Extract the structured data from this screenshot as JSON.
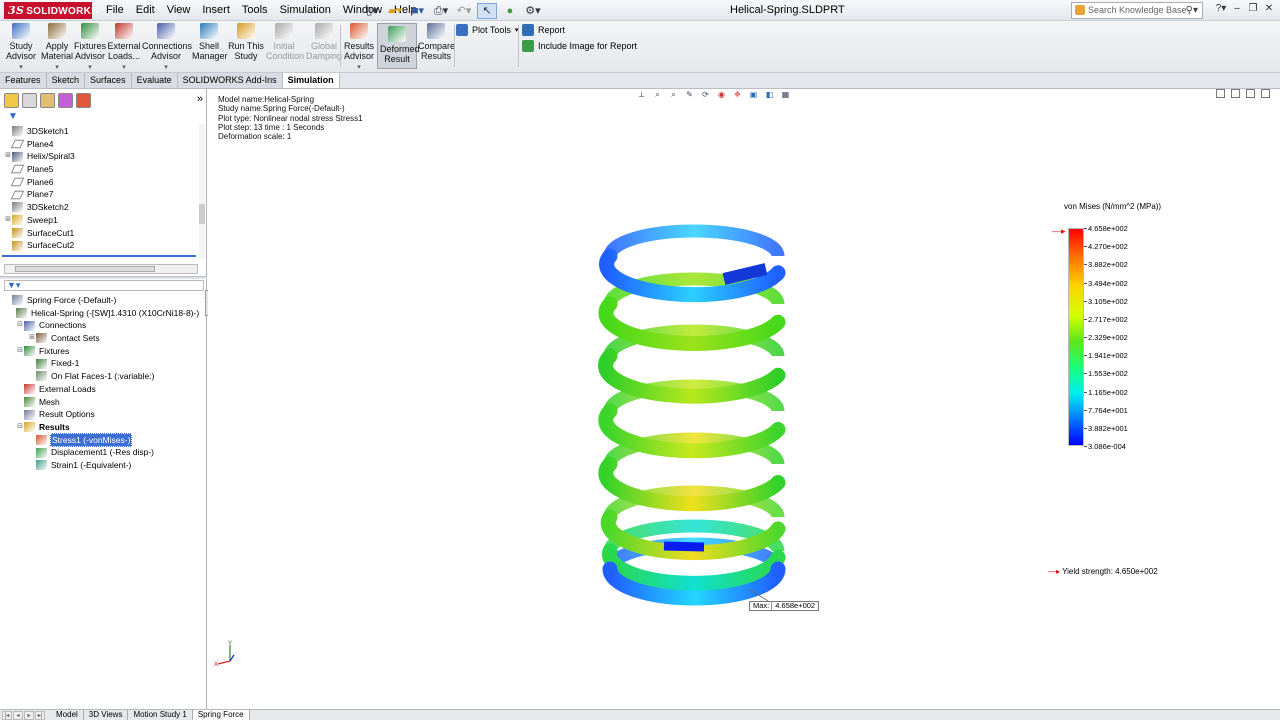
{
  "app": {
    "logo": "SOLIDWORKS",
    "logo_mark": "3S",
    "title": "Helical-Spring.SLDPRT",
    "menu": [
      "File",
      "Edit",
      "View",
      "Insert",
      "Tools",
      "Simulation",
      "Window",
      "Help"
    ],
    "search_placeholder": "Search Knowledge Base"
  },
  "ribbon": {
    "buttons": [
      {
        "label": "Study\nAdvisor",
        "icon": "study-advisor-icon",
        "color": "#3a6fc4"
      },
      {
        "label": "Apply\nMaterial",
        "icon": "material-icon",
        "color": "#8a6a3a"
      },
      {
        "label": "Fixtures\nAdvisor",
        "icon": "fixtures-icon",
        "color": "#2f8b3f"
      },
      {
        "label": "External\nLoads...",
        "icon": "loads-icon",
        "color": "#c4362f"
      },
      {
        "label": "Connections\nAdvisor",
        "icon": "connections-icon",
        "color": "#4a5fa8"
      },
      {
        "label": "Shell\nManager",
        "icon": "shell-icon",
        "color": "#2a7ab8"
      },
      {
        "label": "Run This\nStudy",
        "icon": "run-icon",
        "color": "#d69a1e"
      },
      {
        "label": "Initial\nCondition",
        "icon": "initial-condition-icon",
        "color": "#aaaaaa"
      },
      {
        "label": "Global\nDamping",
        "icon": "damping-icon",
        "color": "#aaaaaa"
      },
      {
        "label": "Results\nAdvisor",
        "icon": "results-icon",
        "color": "#d8562a"
      },
      {
        "label": "Deformed\nResult",
        "icon": "deformed-icon",
        "color": "#3f9c5a"
      },
      {
        "label": "Compare\nResults",
        "icon": "compare-icon",
        "color": "#5a6f9a"
      }
    ],
    "plot_tools": "Plot Tools",
    "report": "Report",
    "include_image": "Include Image for Report"
  },
  "cm_tabs": [
    "Features",
    "Sketch",
    "Surfaces",
    "Evaluate",
    "SOLIDWORKS Add-Ins",
    "Simulation"
  ],
  "feature_tree": [
    {
      "label": "3DSketch1",
      "icon": "sketch3d-icon",
      "expand": ""
    },
    {
      "label": "Plane4",
      "icon": "plane-icon",
      "expand": ""
    },
    {
      "label": "Helix/Spiral3",
      "icon": "helix-icon",
      "expand": "+"
    },
    {
      "label": "Plane5",
      "icon": "plane-icon",
      "expand": ""
    },
    {
      "label": "Plane6",
      "icon": "plane-icon",
      "expand": ""
    },
    {
      "label": "Plane7",
      "icon": "plane-icon",
      "expand": ""
    },
    {
      "label": "3DSketch2",
      "icon": "sketch3d-icon",
      "expand": ""
    },
    {
      "label": "Sweep1",
      "icon": "sweep-icon",
      "expand": "+"
    },
    {
      "label": "SurfaceCut1",
      "icon": "surface-cut-icon",
      "expand": ""
    },
    {
      "label": "SurfaceCut2",
      "icon": "surface-cut-icon",
      "expand": ""
    }
  ],
  "sim_tree": [
    {
      "label": "Spring Force (-Default-)",
      "icon": "study-icon",
      "expand": "",
      "indent": 0
    },
    {
      "label": "Helical-Spring (-[SW]1.4310 (X10CrNi18-8)-)",
      "icon": "part-icon",
      "expand": "",
      "indent": 1
    },
    {
      "label": "Connections",
      "icon": "connections-icon",
      "expand": "-",
      "indent": 1
    },
    {
      "label": "Contact Sets",
      "icon": "contact-icon",
      "expand": "+",
      "indent": 2
    },
    {
      "label": "Fixtures",
      "icon": "fixtures-icon",
      "expand": "-",
      "indent": 1
    },
    {
      "label": "Fixed-1",
      "icon": "fixed-icon",
      "expand": "",
      "indent": 2
    },
    {
      "label": "On Flat Faces-1 (:variable:)",
      "icon": "flat-faces-icon",
      "expand": "",
      "indent": 2
    },
    {
      "label": "External Loads",
      "icon": "loads-icon",
      "expand": "",
      "indent": 1
    },
    {
      "label": "Mesh",
      "icon": "mesh-icon",
      "expand": "",
      "indent": 1
    },
    {
      "label": "Result Options",
      "icon": "result-options-icon",
      "expand": "",
      "indent": 1
    },
    {
      "label": "Results",
      "icon": "results-folder-icon",
      "expand": "-",
      "indent": 1,
      "bold": true
    },
    {
      "label": "Stress1 (-vonMises-)",
      "icon": "stress-plot-icon",
      "expand": "",
      "indent": 2,
      "selected": true
    },
    {
      "label": "Displacement1 (-Res disp-)",
      "icon": "displacement-plot-icon",
      "expand": "",
      "indent": 2
    },
    {
      "label": "Strain1 (-Equivalent-)",
      "icon": "strain-plot-icon",
      "expand": "",
      "indent": 2
    }
  ],
  "viewport": {
    "info_lines": [
      "Model name:Helical-Spring",
      "Study name:Spring Force(-Default-)",
      "Plot type: Nonlinear nodal stress Stress1",
      "Plot step: 13   time : 1 Seconds",
      "Deformation scale: 1"
    ],
    "legend_title": "von Mises (N/mm^2 (MPa))",
    "legend_values": [
      "4.658e+002",
      "4.270e+002",
      "3.882e+002",
      "3.494e+002",
      "3.105e+002",
      "2.717e+002",
      "2.329e+002",
      "1.941e+002",
      "1.553e+002",
      "1.165e+002",
      "7.764e+001",
      "3.882e+001",
      "3.086e-004"
    ],
    "yield_strength": "Yield strength: 4.650e+002",
    "probe_label": "Max:",
    "probe_value": "4.658e+002",
    "triad_y": "Y",
    "triad_x": "X"
  },
  "bottom_tabs": [
    "Model",
    "3D Views",
    "Motion Study 1",
    "Spring Force"
  ],
  "active_bottom_tab": "Spring Force"
}
